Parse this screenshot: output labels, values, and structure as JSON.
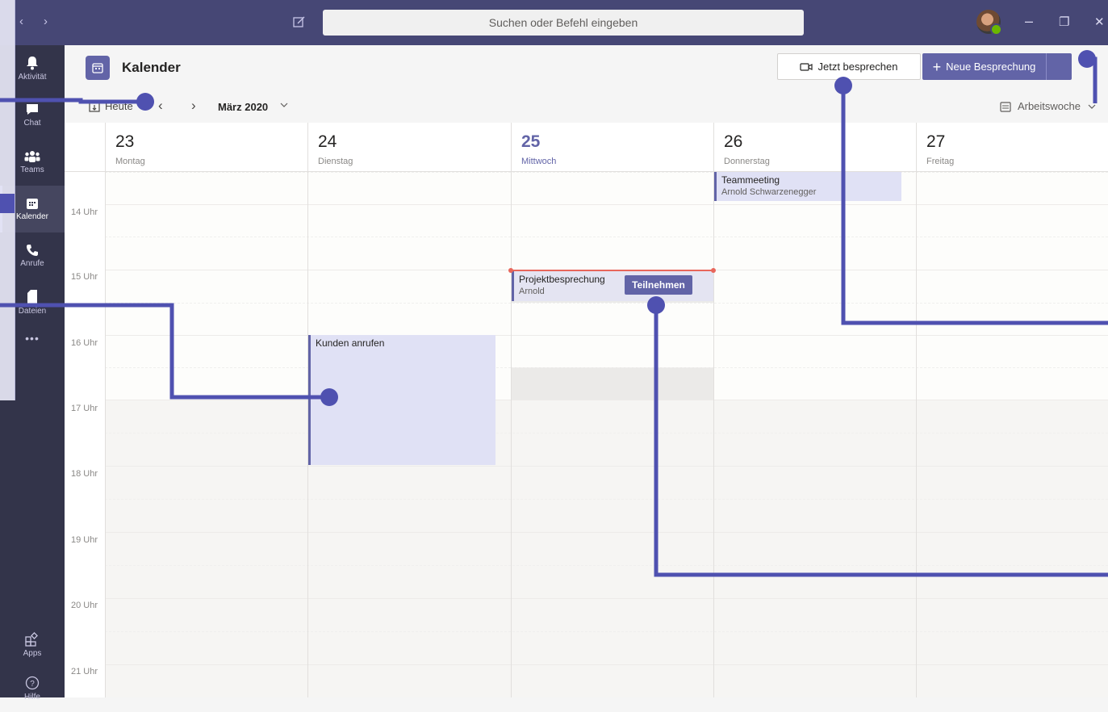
{
  "titlebar": {
    "back_glyph": "‹",
    "forward_glyph": "›",
    "search_placeholder": "Suchen oder Befehl eingeben",
    "minimize_glyph": "–",
    "maximize_glyph": "❐",
    "close_glyph": "✕"
  },
  "rail": {
    "items": [
      {
        "label": "Aktivität",
        "icon": "bell-icon"
      },
      {
        "label": "Chat",
        "icon": "chat-icon"
      },
      {
        "label": "Teams",
        "icon": "teams-icon"
      },
      {
        "label": "Kalender",
        "icon": "calendar-icon",
        "active": true
      },
      {
        "label": "Anrufe",
        "icon": "phone-icon"
      },
      {
        "label": "Dateien",
        "icon": "file-icon"
      }
    ],
    "more_glyph": "•••",
    "apps_label": "Apps",
    "help_label": "Hilfe"
  },
  "header": {
    "title": "Kalender",
    "meet_now_label": "Jetzt besprechen",
    "new_meeting_label": "Neue Besprechung"
  },
  "toolbar": {
    "today_label": "Heute",
    "prev_glyph": "‹",
    "next_glyph": "›",
    "month_label": "März 2020",
    "view_label": "Arbeitswoche"
  },
  "days": [
    {
      "num": "23",
      "weekday": "Montag"
    },
    {
      "num": "24",
      "weekday": "Dienstag"
    },
    {
      "num": "25",
      "weekday": "Mittwoch",
      "today": true
    },
    {
      "num": "26",
      "weekday": "Donnerstag"
    },
    {
      "num": "27",
      "weekday": "Freitag"
    }
  ],
  "hours": [
    "14 Uhr",
    "15 Uhr",
    "16 Uhr",
    "17 Uhr",
    "18 Uhr",
    "19 Uhr",
    "20 Uhr",
    "21 Uhr"
  ],
  "events": {
    "teammeeting": {
      "title": "Teammeeting",
      "organizer": "Arnold Schwarzenegger"
    },
    "projekt": {
      "title": "Projektbesprechung",
      "organizer": "Arnold",
      "join_label": "Teilnehmen"
    },
    "kunden": {
      "title": "Kunden anrufen"
    }
  },
  "colors": {
    "brand": "#6264a7",
    "titlebar": "#464775",
    "rail": "#33344a",
    "event_bg": "#e0e1f5",
    "now_line": "#e8665b",
    "callout": "#4f51b0"
  }
}
